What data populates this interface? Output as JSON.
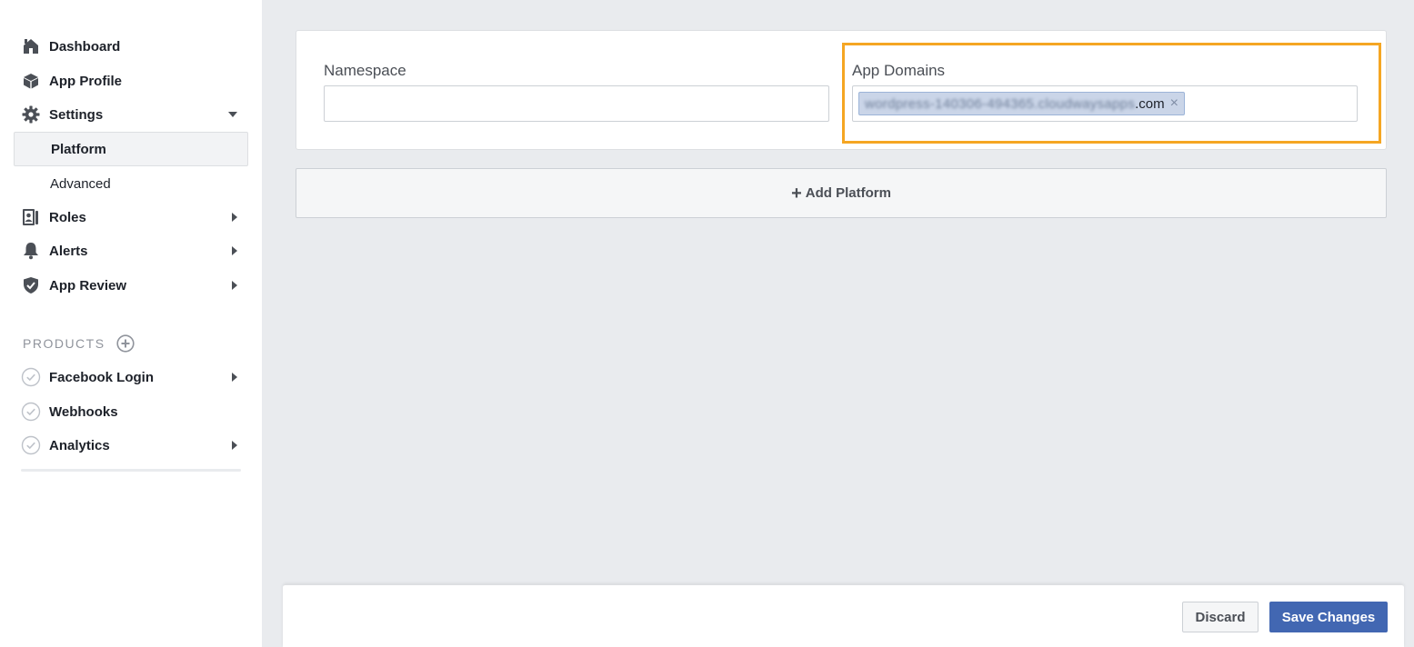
{
  "sidebar": {
    "items": [
      {
        "label": "Dashboard",
        "icon": "house-icon"
      },
      {
        "label": "App Profile",
        "icon": "box-icon"
      },
      {
        "label": "Settings",
        "icon": "gear-icon",
        "expanded": true
      },
      {
        "label": "Platform",
        "active": true
      },
      {
        "label": "Advanced"
      },
      {
        "label": "Roles",
        "icon": "roles-icon"
      },
      {
        "label": "Alerts",
        "icon": "bell-icon"
      },
      {
        "label": "App Review",
        "icon": "shield-icon"
      }
    ],
    "products_header": "PRODUCTS",
    "products": [
      {
        "label": "Facebook Login",
        "icon": "check-circle-icon"
      },
      {
        "label": "Webhooks",
        "icon": "check-circle-icon"
      },
      {
        "label": "Analytics",
        "icon": "check-circle-icon"
      }
    ]
  },
  "main": {
    "namespace_label": "Namespace",
    "namespace_value": "",
    "app_domains_label": "App Domains",
    "app_domain_token_blurred": "wordpress-140306-494365.cloudwaysapps",
    "app_domain_token_suffix": ".com",
    "token_remove": "×",
    "add_platform_label": "Add Platform",
    "add_platform_icon": "plus-icon",
    "highlight_color": "#f5a623"
  },
  "footer": {
    "discard_label": "Discard",
    "save_label": "Save Changes",
    "save_color": "#4267b2"
  }
}
